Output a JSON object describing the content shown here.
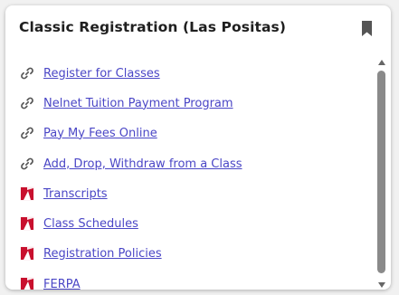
{
  "card": {
    "title": "Classic Registration (Las Positas)",
    "bookmark_icon": "bookmark-icon"
  },
  "items": [
    {
      "label": "Register for Classes",
      "icon": "link-icon"
    },
    {
      "label": "Nelnet Tuition Payment Program",
      "icon": "link-icon"
    },
    {
      "label": "Pay My Fees Online",
      "icon": "link-icon"
    },
    {
      "label": "Add, Drop, Withdraw from a Class",
      "icon": "link-icon"
    },
    {
      "label": "Transcripts",
      "icon": "app-logo-icon"
    },
    {
      "label": "Class Schedules",
      "icon": "app-logo-icon"
    },
    {
      "label": "Registration Policies",
      "icon": "app-logo-icon"
    },
    {
      "label": "FERPA",
      "icon": "app-logo-icon"
    }
  ],
  "colors": {
    "link": "#4a46c6",
    "title": "#1f1f1f",
    "logo_red": "#c8102e"
  }
}
